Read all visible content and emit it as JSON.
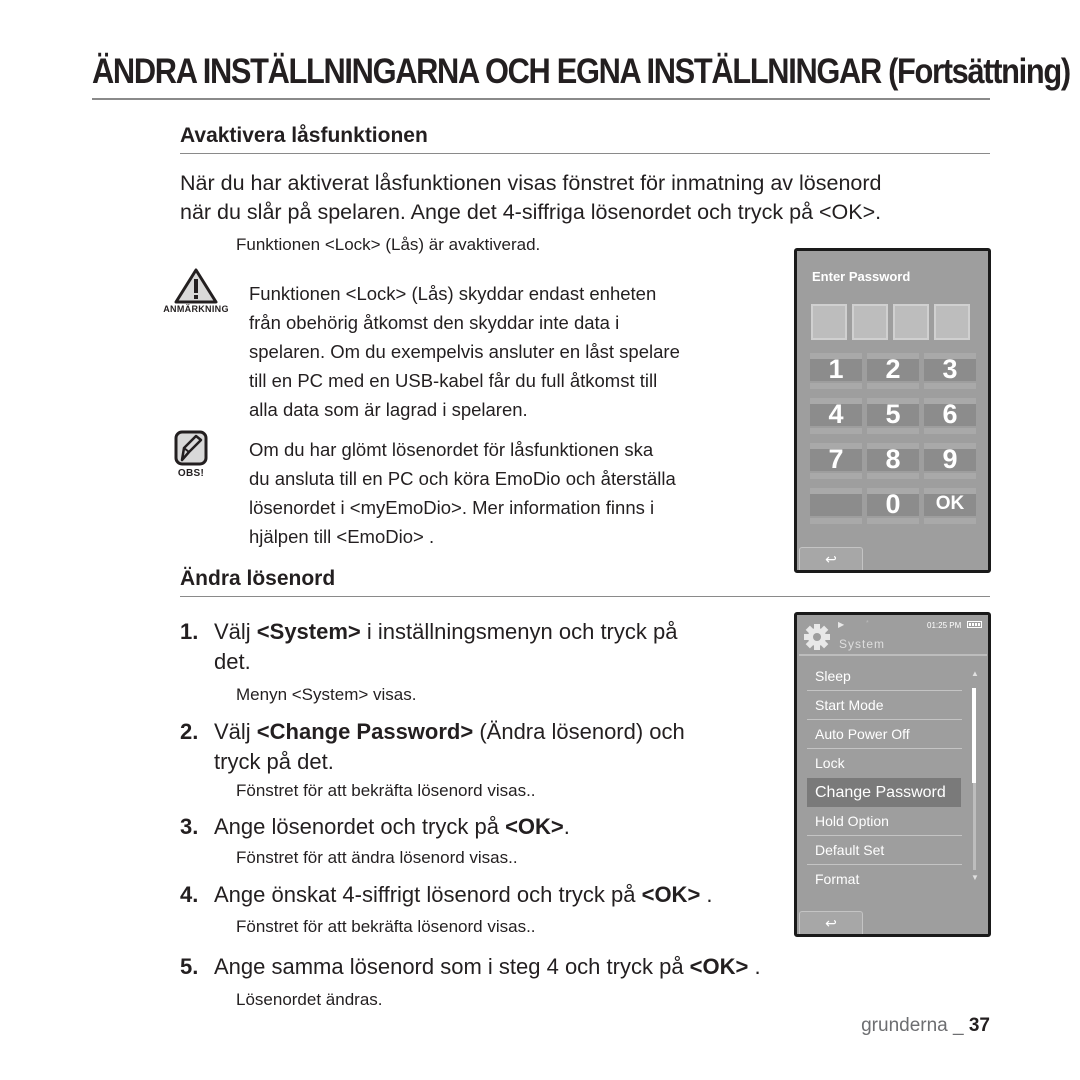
{
  "page": {
    "title": "ÄNDRA INSTÄLLNINGARNA OCH EGNA INSTÄLLNINGAR (Fortsättning)",
    "footer_section": "grunderna _ ",
    "footer_page": "37"
  },
  "deactivate": {
    "heading": "Avaktivera låsfunktionen",
    "intro_line1": "När du har aktiverat låsfunktionen visas fönstret för inmatning av lösenord",
    "intro_line2": "när du slår på spelaren. Ange det 4-siffriga lösenordet och tryck på <OK>.",
    "result": "Funktionen <Lock> (Lås) är avaktiverad.",
    "note": {
      "label": "ANMÄRKNING",
      "icon": "warning-triangle-icon",
      "lines": [
        "Funktionen <Lock> (Lås) skyddar endast enheten",
        "från obehörig åtkomst den skyddar inte data i",
        "spelaren. Om du exempelvis ansluter en låst spelare",
        "till en PC med en USB-kabel får du full åtkomst till",
        "alla data som är lagrad i spelaren."
      ]
    },
    "obs": {
      "label": "OBS!",
      "icon": "pencil-note-icon",
      "lines": [
        "Om du har glömt lösenordet för låsfunktionen ska",
        "du ansluta till en PC och köra EmoDio och återställa",
        "lösenordet i <myEmoDio>. Mer information finns i",
        "hjälpen till <EmoDio> ."
      ]
    }
  },
  "password_screen": {
    "title": "Enter Password",
    "keys": [
      "1",
      "2",
      "3",
      "4",
      "5",
      "6",
      "7",
      "8",
      "9",
      "",
      "0",
      "OK"
    ],
    "back_icon": "↩"
  },
  "change": {
    "heading": "Ändra lösenord",
    "steps": [
      {
        "num": "1.",
        "pre": "Välj ",
        "bold": "<System>",
        "post": " i inställningsmenyn och tryck på",
        "cont": "det.",
        "result": "Menyn <System> visas."
      },
      {
        "num": "2.",
        "pre": "Välj ",
        "bold": "<Change Password>",
        "post": " (Ändra lösenord) och",
        "cont": "tryck på det.",
        "result": "Fönstret för att bekräfta lösenord visas.."
      },
      {
        "num": "3.",
        "pre": "Ange lösenordet och tryck på ",
        "bold": "<OK>",
        "post": ".",
        "result": "Fönstret för att ändra lösenord visas.."
      },
      {
        "num": "4.",
        "pre": "Ange önskat 4-siffrigt lösenord och tryck på ",
        "bold": "<OK>",
        "post": " .",
        "result": "Fönstret för att bekräfta lösenord visas.."
      },
      {
        "num": "5.",
        "pre": "Ange samma lösenord som i steg 4 och tryck på ",
        "bold": "<OK>",
        "post": " .",
        "result": "Lösenordet ändras."
      }
    ]
  },
  "system_screen": {
    "header": "System",
    "time": "01:25 PM",
    "menu": [
      "Sleep",
      "Start Mode",
      "Auto Power Off",
      "Lock",
      "Change Password",
      "Hold Option",
      "Default Set",
      "Format"
    ],
    "selected": "Change Password",
    "back_icon": "↩"
  }
}
